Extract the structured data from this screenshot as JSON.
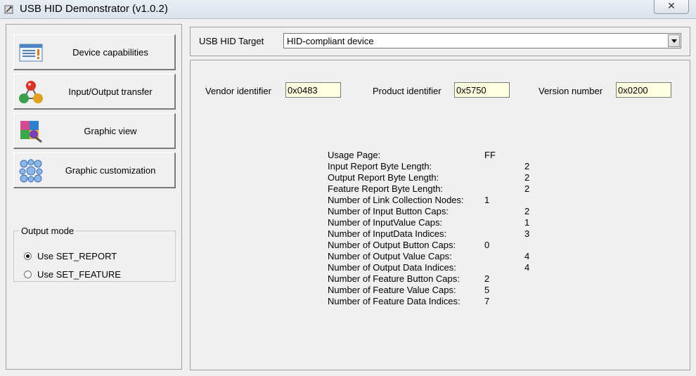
{
  "window": {
    "title": "USB HID Demonstrator (v1.0.2)",
    "close_glyph": "✕"
  },
  "nav": [
    {
      "label": "Device capabilities",
      "icon": "document-list-icon"
    },
    {
      "label": "Input/Output transfer",
      "icon": "transfer-spheres-icon"
    },
    {
      "label": "Graphic view",
      "icon": "puzzle-graphic-icon"
    },
    {
      "label": "Graphic customization",
      "icon": "bubbles-grid-icon"
    }
  ],
  "output_mode": {
    "legend": "Output mode",
    "options": [
      {
        "label": "Use SET_REPORT",
        "checked": true
      },
      {
        "label": "Use SET_FEATURE",
        "checked": false
      }
    ]
  },
  "target": {
    "label": "USB HID Target",
    "selected": "HID-compliant device"
  },
  "ids": {
    "vendor_label": "Vendor identifier",
    "vendor_value": "0x0483",
    "product_label": "Product identifier",
    "product_value": "0x5750",
    "version_label": "Version number",
    "version_value": "0x0200"
  },
  "capabilities": [
    {
      "label": "Usage Page:",
      "value": "FF",
      "col": 1
    },
    {
      "label": "Input Report Byte Length:",
      "value": "2",
      "col": 2
    },
    {
      "label": "Output Report Byte Length:",
      "value": "2",
      "col": 2
    },
    {
      "label": "Feature Report Byte Length:",
      "value": "2",
      "col": 2
    },
    {
      "label": "Number of Link Collection Nodes:",
      "value": "1",
      "col": 1
    },
    {
      "label": "Number of Input Button Caps:",
      "value": "2",
      "col": 2
    },
    {
      "label": "Number of InputValue Caps:",
      "value": "1",
      "col": 2
    },
    {
      "label": "Number of InputData Indices:",
      "value": "3",
      "col": 2
    },
    {
      "label": "Number of Output Button Caps:",
      "value": "0",
      "col": 1
    },
    {
      "label": "Number of Output Value Caps:",
      "value": "4",
      "col": 2
    },
    {
      "label": "Number of Output Data Indices:",
      "value": "4",
      "col": 2
    },
    {
      "label": "Number of Feature Button Caps:",
      "value": "2",
      "col": 1
    },
    {
      "label": "Number of Feature Value Caps:",
      "value": "5",
      "col": 1
    },
    {
      "label": "Number of Feature Data Indices:",
      "value": "7",
      "col": 1
    }
  ]
}
